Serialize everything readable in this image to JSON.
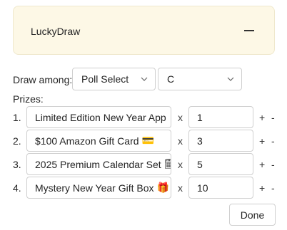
{
  "header": {
    "title": "LuckyDraw",
    "collapse_icon": "minus-icon"
  },
  "draw_among": {
    "label": "Draw among:",
    "select1_value": "Poll Select",
    "select2_value": "C"
  },
  "prizes": {
    "label": "Prizes:",
    "rows": [
      {
        "index": "1.",
        "name": "Limited Edition New Year App",
        "emoji": "",
        "times": "x",
        "qty": "1",
        "plus": "+",
        "minus": "-"
      },
      {
        "index": "2.",
        "name": "$100 Amazon Gift Card",
        "emoji": "💳",
        "times": "x",
        "qty": "3",
        "plus": "+",
        "minus": "-"
      },
      {
        "index": "3.",
        "name": "2025 Premium Calendar Set",
        "emoji": "🗓",
        "times": "x",
        "qty": "5",
        "plus": "+",
        "minus": "-"
      },
      {
        "index": "4.",
        "name": "Mystery New Year Gift Box",
        "emoji": "🎁",
        "times": "x",
        "qty": "10",
        "plus": "+",
        "minus": "-"
      }
    ]
  },
  "footer": {
    "done_label": "Done"
  },
  "colors": {
    "header_bg": "#fdf8e6",
    "border": "#cfcfcf",
    "text": "#242424"
  }
}
